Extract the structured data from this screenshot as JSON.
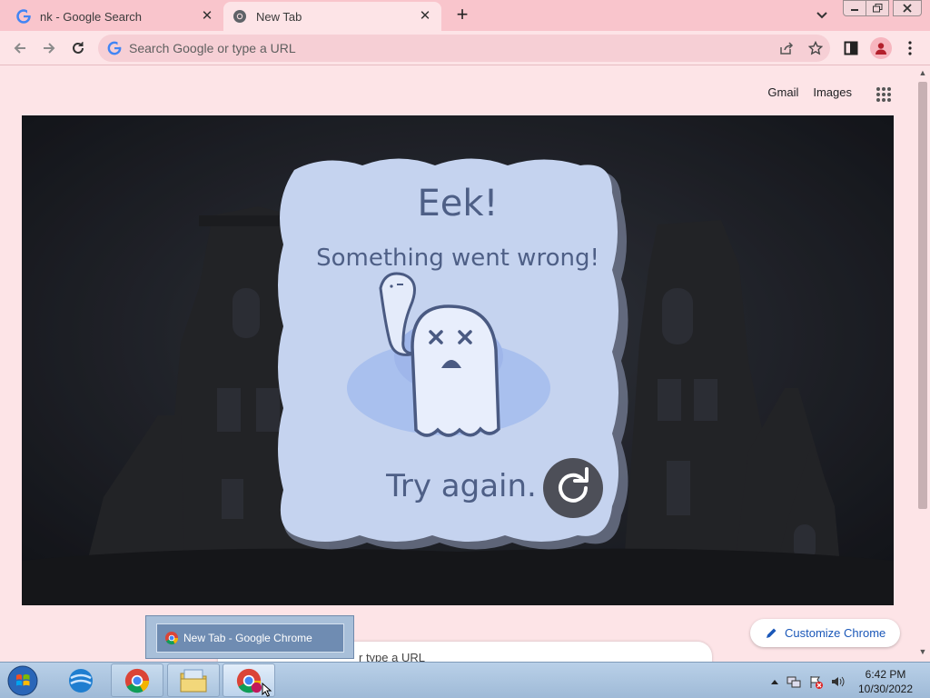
{
  "browser": {
    "tabs": [
      {
        "title": "nk - Google Search",
        "active": false
      },
      {
        "title": "New Tab",
        "active": true
      }
    ],
    "omnibox": {
      "placeholder": "Search Google or type a URL",
      "value": ""
    }
  },
  "page": {
    "top_links": [
      "Gmail",
      "Images"
    ],
    "doodle": {
      "heading": "Eek!",
      "subheading": "Something went wrong!",
      "action_text": "Try again."
    },
    "customize_label": "Customize Chrome",
    "searchbox_partial_text": "r type a URL"
  },
  "taskbar": {
    "thumbnail_title": "New Tab - Google Chrome",
    "clock_time": "6:42 PM",
    "clock_date": "10/30/2022"
  },
  "colors": {
    "tabstrip": "#f9c5cc",
    "page_bg": "#fde4e7",
    "card": "#c5d3ef",
    "card_text": "#4e5f86",
    "link": "#1a57b8"
  }
}
